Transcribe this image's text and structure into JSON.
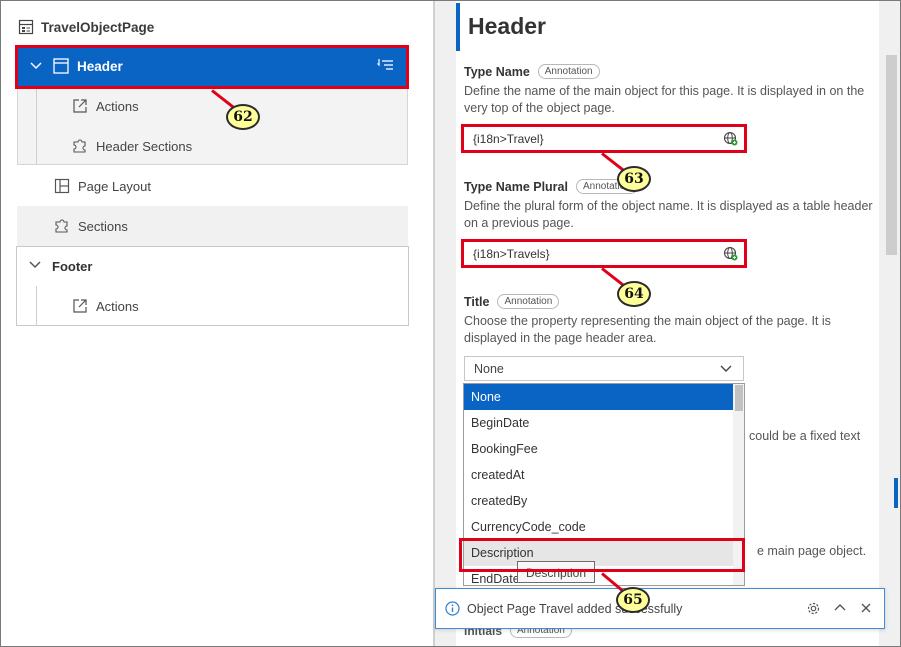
{
  "tree": {
    "root": "TravelObjectPage",
    "header": "Header",
    "header_children": [
      "Actions",
      "Header Sections"
    ],
    "page_layout": "Page Layout",
    "sections": "Sections",
    "footer": "Footer",
    "footer_children": [
      "Actions"
    ]
  },
  "callouts": [
    "62",
    "63",
    "64",
    "65"
  ],
  "editor": {
    "title": "Header",
    "type_name": {
      "label": "Type Name",
      "badge": "Annotation",
      "description": "Define the name of the main object for this page. It is displayed in on the very top of the object page.",
      "value": "{i18n>Travel}"
    },
    "type_name_plural": {
      "label": "Type Name Plural",
      "badge": "Annotation",
      "description": "Define the plural form of the object name. It is displayed as a table header on a previous page.",
      "value": "{i18n>Travels}"
    },
    "title_field": {
      "label": "Title",
      "badge": "Annotation",
      "description": "Choose the property representing the main object of the page. It is displayed in the page header area.",
      "selected": "None"
    },
    "dropdown_options": [
      "None",
      "BeginDate",
      "BookingFee",
      "createdAt",
      "createdBy",
      "CurrencyCode_code",
      "Description",
      "EndDate"
    ],
    "tooltip": "Description",
    "partial_text_1": "could be a fixed text",
    "partial_text_2": "e main page object.",
    "hidden_label": "Initials",
    "hidden_badge": "Annotation"
  },
  "toast": {
    "message": "Object Page Travel added successfully"
  },
  "colors": {
    "accent": "#0a64c4",
    "callout_border": "#e1001a",
    "callout_fill": "#ffff99"
  }
}
